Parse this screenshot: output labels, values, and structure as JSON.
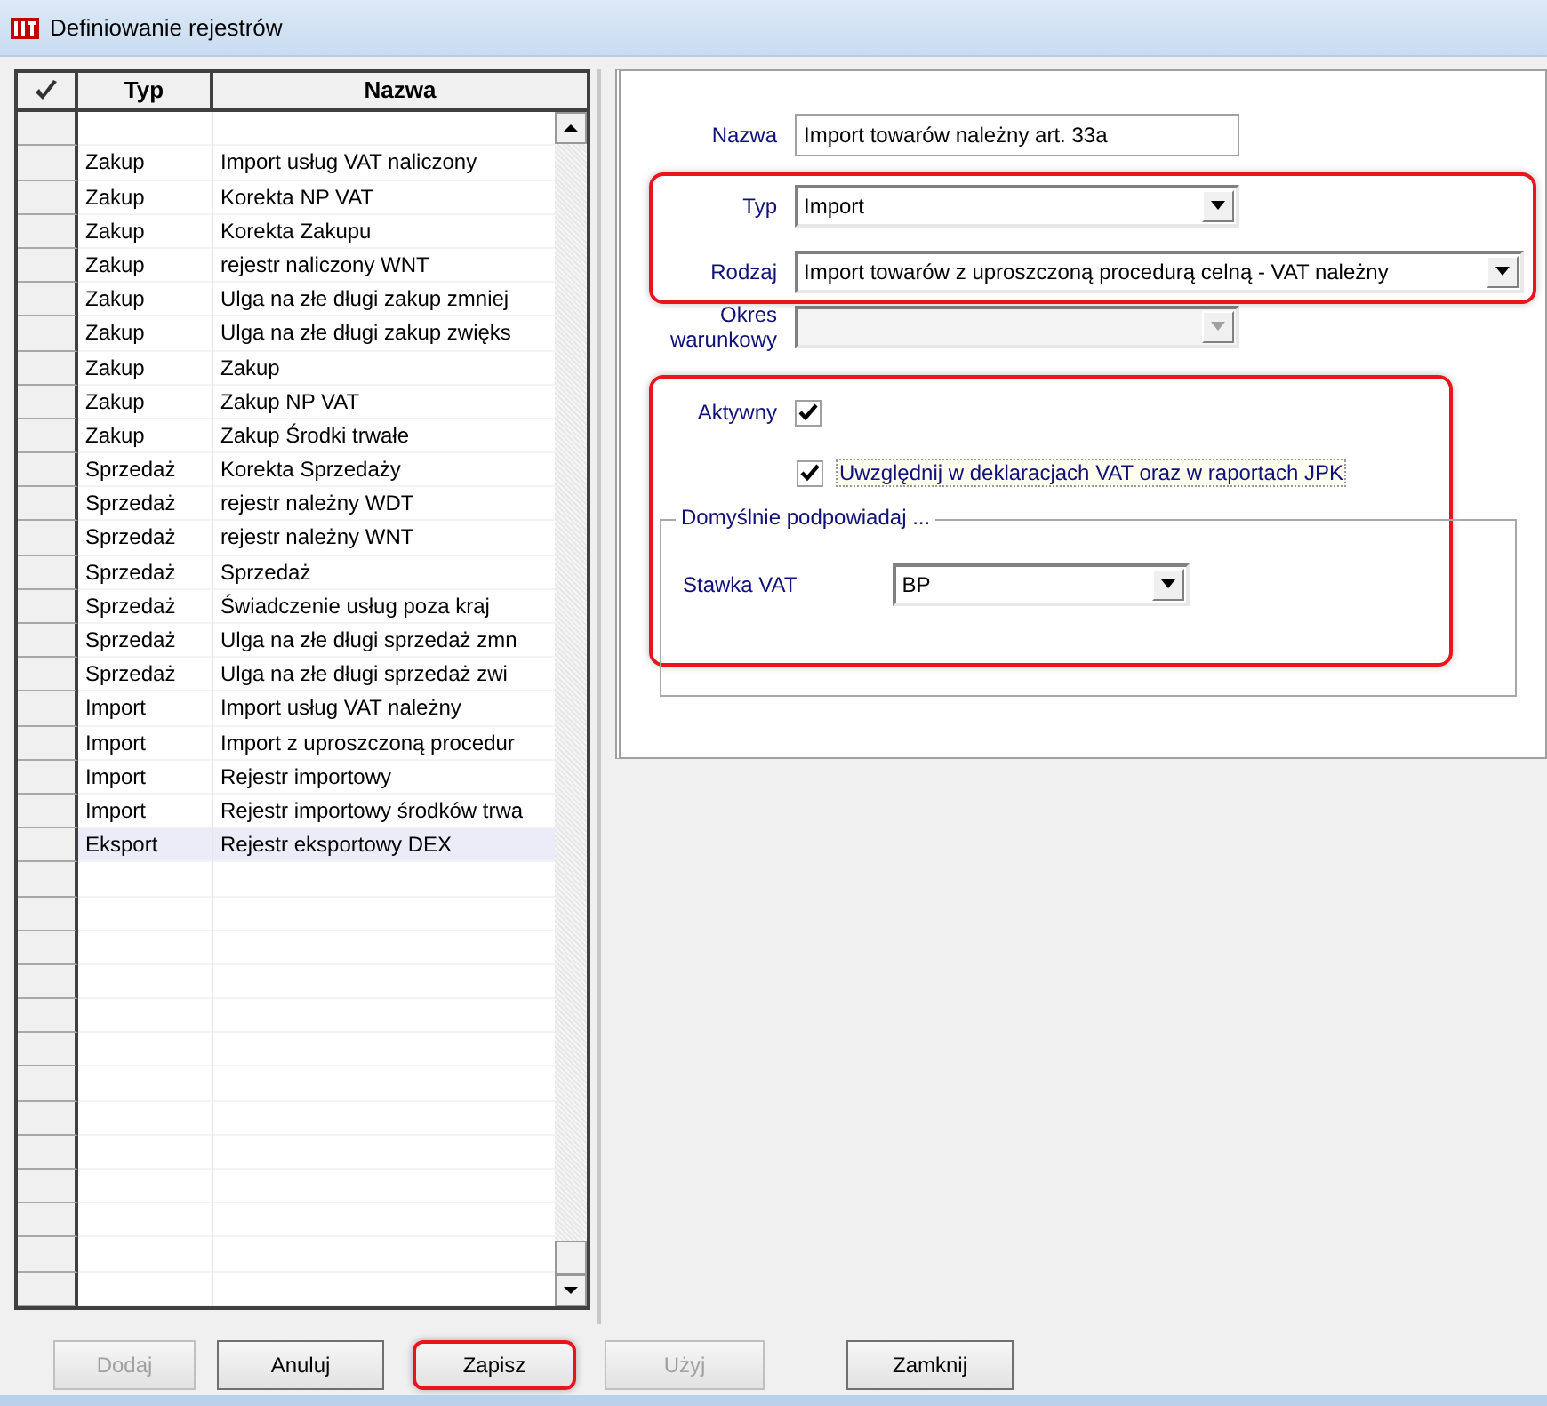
{
  "window": {
    "title": "Definiowanie rejestrów"
  },
  "table": {
    "columns": [
      "Typ",
      "Nazwa"
    ],
    "rows": [
      {
        "typ": "Zakup",
        "nazwa": "Import usług VAT  naliczony",
        "selected": false
      },
      {
        "typ": "Zakup",
        "nazwa": "Korekta NP VAT",
        "selected": false
      },
      {
        "typ": "Zakup",
        "nazwa": "Korekta Zakupu",
        "selected": false
      },
      {
        "typ": "Zakup",
        "nazwa": "rejestr naliczony WNT",
        "selected": false
      },
      {
        "typ": "Zakup",
        "nazwa": "Ulga na złe długi zakup zmniej",
        "selected": false
      },
      {
        "typ": "Zakup",
        "nazwa": "Ulga na złe długi zakup zwięks",
        "selected": false
      },
      {
        "typ": "Zakup",
        "nazwa": "Zakup",
        "selected": false
      },
      {
        "typ": "Zakup",
        "nazwa": "Zakup NP VAT",
        "selected": false
      },
      {
        "typ": "Zakup",
        "nazwa": "Zakup Środki trwałe",
        "selected": false
      },
      {
        "typ": "Sprzedaż",
        "nazwa": "Korekta Sprzedaży",
        "selected": false
      },
      {
        "typ": "Sprzedaż",
        "nazwa": "rejestr należny WDT",
        "selected": false
      },
      {
        "typ": "Sprzedaż",
        "nazwa": "rejestr należny WNT",
        "selected": false
      },
      {
        "typ": "Sprzedaż",
        "nazwa": "Sprzedaż",
        "selected": false
      },
      {
        "typ": "Sprzedaż",
        "nazwa": "Świadczenie usług poza kraj",
        "selected": false
      },
      {
        "typ": "Sprzedaż",
        "nazwa": "Ulga na złe długi sprzedaż zmn",
        "selected": false
      },
      {
        "typ": "Sprzedaż",
        "nazwa": "Ulga na złe długi sprzedaż zwi",
        "selected": false
      },
      {
        "typ": "Import",
        "nazwa": "Import usług VAT  należny",
        "selected": false
      },
      {
        "typ": "Import",
        "nazwa": "Import z uproszczoną procedur",
        "selected": false
      },
      {
        "typ": "Import",
        "nazwa": "Rejestr importowy",
        "selected": false
      },
      {
        "typ": "Import",
        "nazwa": "Rejestr importowy środków trwa",
        "selected": false
      },
      {
        "typ": "Eksport",
        "nazwa": "Rejestr eksportowy DEX",
        "selected": true
      }
    ]
  },
  "form": {
    "nazwa": {
      "label": "Nazwa",
      "value": "Import towarów należny art. 33a"
    },
    "type_group": {
      "highlighted": true,
      "typ": {
        "label": "Typ",
        "value": "Import"
      },
      "rodzaj": {
        "label": "Rodzaj",
        "value": "Import towarów z uproszczoną procedurą celną - VAT należny"
      }
    },
    "okres": {
      "label": "Okres warunkowy",
      "disabled": true
    },
    "active_group": {
      "highlighted": true,
      "aktywny": {
        "label": "Aktywny",
        "checked": true
      },
      "uwzglednij": {
        "label": "Uwzględnij w deklaracjach VAT oraz w raportach JPK",
        "checked": true
      },
      "defaults": {
        "title": "Domyślnie podpowiadaj ...",
        "stawka": {
          "label": "Stawka VAT",
          "value": "BP"
        }
      }
    }
  },
  "buttons": [
    {
      "label": "Dodaj",
      "disabled": true,
      "highlighted": false
    },
    {
      "label": "Anuluj",
      "disabled": false,
      "highlighted": false
    },
    {
      "label": "Zapisz",
      "disabled": false,
      "highlighted": true
    },
    {
      "label": "Użyj",
      "disabled": true,
      "highlighted": false
    },
    {
      "label": "Zamknij",
      "disabled": false,
      "highlighted": false
    }
  ]
}
